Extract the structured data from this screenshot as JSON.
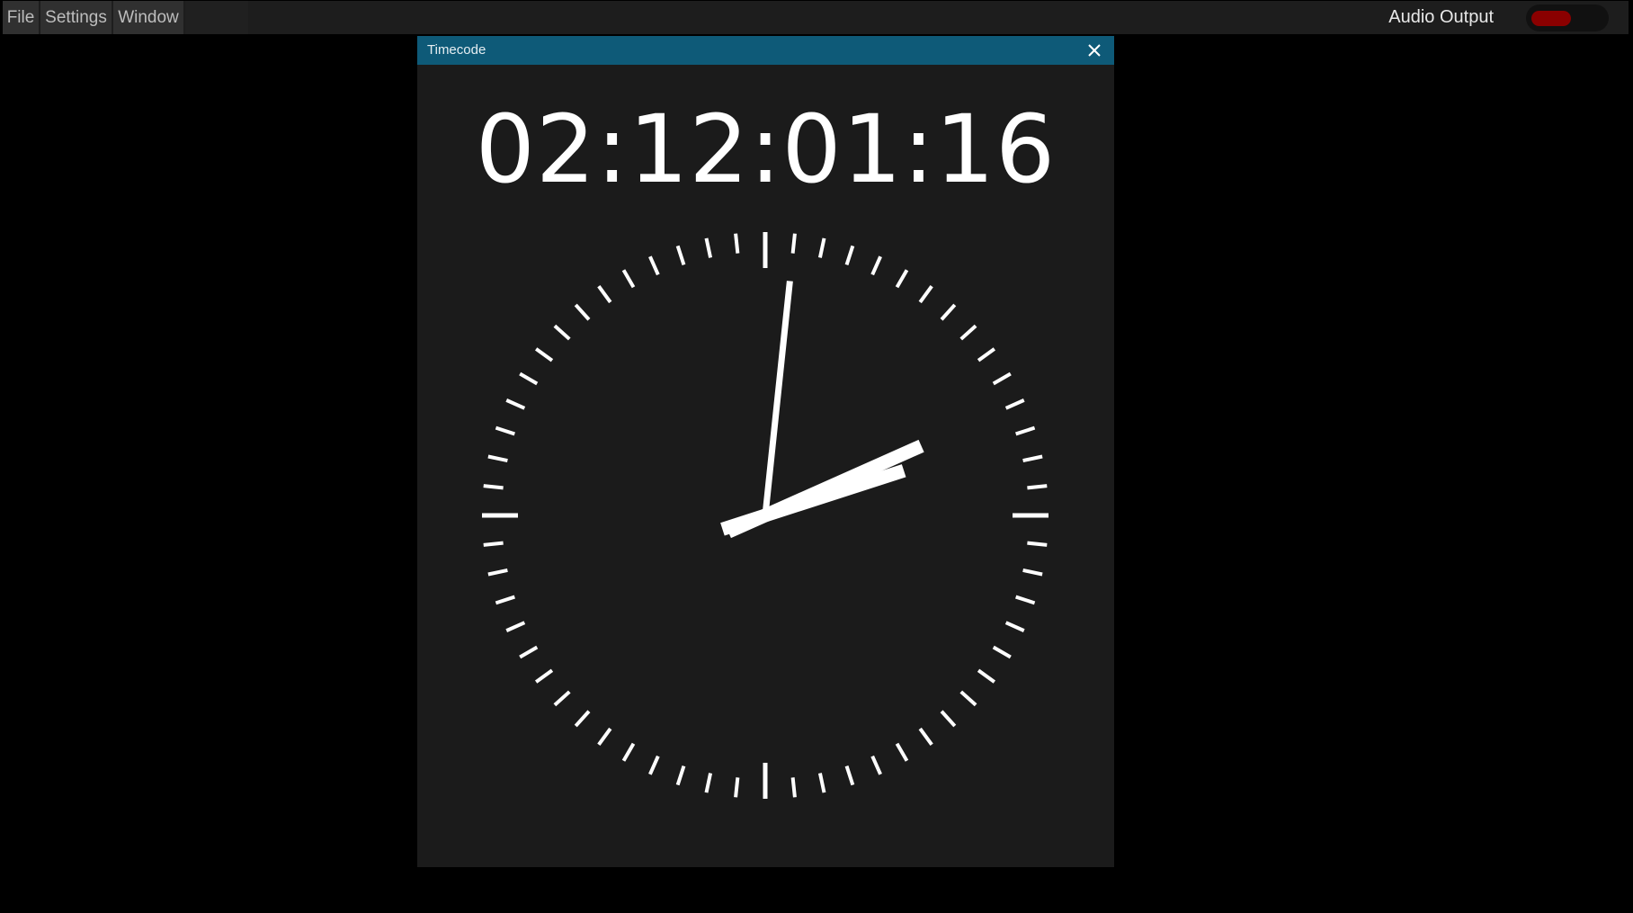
{
  "menubar": {
    "items": [
      {
        "label": "File"
      },
      {
        "label": "Settings"
      },
      {
        "label": "Window"
      }
    ],
    "audio_output_label": "Audio Output",
    "audio_output_state": "off",
    "audio_toggle_color": "#8a0000"
  },
  "panel": {
    "title": "Timecode",
    "close_icon": "close-icon",
    "header_color": "#0e5a78"
  },
  "timecode": {
    "display": "02:12:01:16",
    "hours": 2,
    "minutes": 12,
    "seconds": 1,
    "frames": 16
  },
  "clock": {
    "type": "analog",
    "hand_color": "#ffffff"
  }
}
